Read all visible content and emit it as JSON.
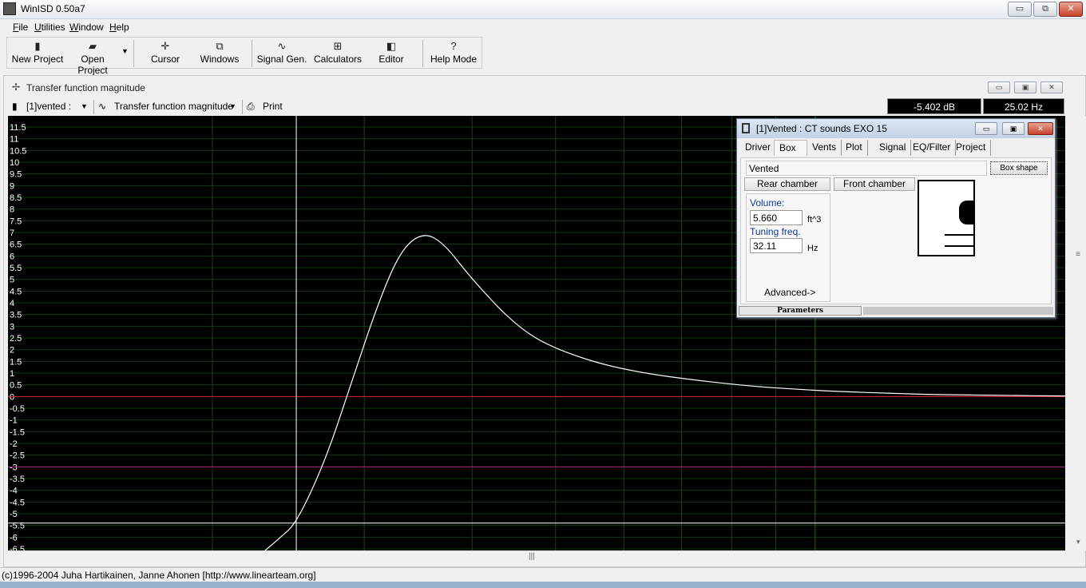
{
  "app": {
    "title": "WinISD 0.50a7"
  },
  "window_controls": {
    "minimize": "▭",
    "maximize": "⧉",
    "close": "✕"
  },
  "menu": [
    "File",
    "Utilities",
    "Window",
    "Help"
  ],
  "toolbar": {
    "new_project": "New Project",
    "open_project": "Open Project",
    "cursor": "Cursor",
    "windows": "Windows",
    "signal_gen": "Signal Gen.",
    "calculators": "Calculators",
    "editor": "Editor",
    "help_mode": "Help Mode"
  },
  "graph_window": {
    "title": "Transfer function magnitude",
    "project_select": "[1]vented :",
    "graph_select": "Transfer function magnitude",
    "print": "Print",
    "readout_db": "-5.402 dB",
    "readout_hz": "25.02 Hz"
  },
  "chart_data": {
    "type": "line",
    "title": "",
    "xlabel": "",
    "ylabel": "",
    "ylim": [
      -6.5,
      11.5
    ],
    "y_ticks": [
      "11.5",
      "11",
      "10.5",
      "10",
      "9.5",
      "9",
      "8.5",
      "8",
      "7.5",
      "7",
      "6.5",
      "6",
      "5.5",
      "5",
      "4.5",
      "4",
      "3.5",
      "3",
      "2.5",
      "2",
      "1.5",
      "1",
      "0.5",
      "0",
      "-0.5",
      "-1",
      "-1.5",
      "-2",
      "-2.5",
      "-3",
      "-3.5",
      "-4",
      "-4.5",
      "-5",
      "-5.5",
      "-6",
      "-6.5"
    ],
    "x_scale": "log",
    "grid": true,
    "cursor_hz": 25.02,
    "cursor_db": -5.402,
    "reference_lines_db": [
      0,
      -3
    ],
    "series": [
      {
        "color": "#ffffff",
        "x": [
          20.5,
          22,
          24,
          25.02,
          27,
          29,
          31,
          33,
          35,
          37,
          40,
          45,
          50,
          60,
          80,
          100,
          130,
          160,
          200
        ],
        "y": [
          -8,
          -7.2,
          -6,
          -5.4,
          -2.8,
          0.6,
          3.8,
          6.2,
          7.0,
          6.6,
          5.0,
          3.0,
          2.0,
          1.1,
          0.5,
          0.25,
          0.1,
          0.05,
          0.02
        ]
      }
    ]
  },
  "box_dialog": {
    "title": "[1]Vented : CT sounds EXO 15",
    "tabs": [
      "Driver",
      "Box",
      "Vents",
      "Plot",
      "Signal",
      "EQ/Filter",
      "Project"
    ],
    "active_tab": "Box",
    "box_type": "Vented",
    "box_shape_button": "Box shape",
    "rear_chamber": "Rear chamber",
    "front_chamber": "Front chamber",
    "volume_label": "Volume:",
    "volume_value": "5.660",
    "volume_unit": "ft^3",
    "tuning_label": "Tuning freq.",
    "tuning_value": "32.11",
    "tuning_unit": "Hz",
    "advanced": "Advanced->",
    "parameters": "Parameters"
  },
  "statusbar": {
    "text": "(c)1996-2004 Juha Hartikainen, Janne Ahonen [http://www.linearteam.org]"
  }
}
